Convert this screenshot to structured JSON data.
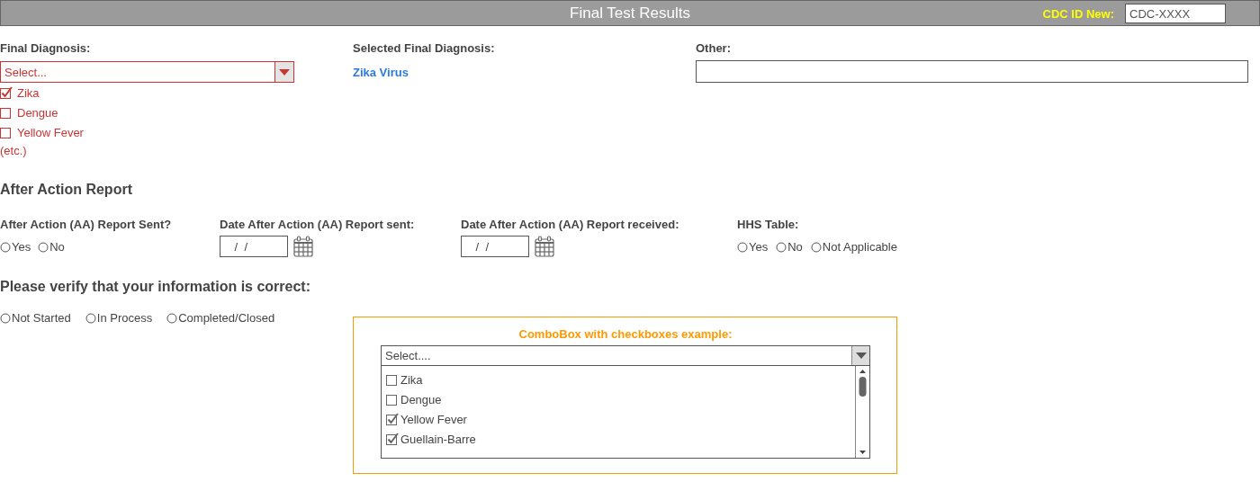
{
  "header": {
    "title": "Final Test Results",
    "id_label": "CDC ID New:",
    "id_value": "CDC-XXXX"
  },
  "final_diagnosis": {
    "label": "Final Diagnosis:",
    "placeholder": "Select...",
    "options": [
      {
        "label": "Zika",
        "checked": true
      },
      {
        "label": "Dengue",
        "checked": false
      },
      {
        "label": "Yellow Fever",
        "checked": false
      }
    ],
    "note": "(etc.)"
  },
  "selected_final_diagnosis": {
    "label": "Selected Final Diagnosis:",
    "value": "Zika Virus"
  },
  "other": {
    "label": "Other:"
  },
  "after_action": {
    "heading": "After Action Report",
    "report_sent": {
      "label": "After Action (AA) Report Sent?",
      "options": [
        {
          "label": "Yes",
          "selected": false
        },
        {
          "label": "No",
          "selected": false
        }
      ]
    },
    "date_sent": {
      "label": "Date After Action (AA) Report sent:",
      "value": " /  /"
    },
    "date_received": {
      "label": "Date After Action (AA) Report received:",
      "value": " /  /"
    },
    "hhs_table": {
      "label": "HHS Table:",
      "options": [
        {
          "label": "Yes",
          "selected": false
        },
        {
          "label": "No",
          "selected": false
        },
        {
          "label": "Not Applicable",
          "selected": false
        }
      ]
    }
  },
  "verify": {
    "heading": "Please verify that your information is correct:",
    "options": [
      {
        "label": "Not Started",
        "selected": false
      },
      {
        "label": "In Process",
        "selected": false
      },
      {
        "label": "Completed/Closed",
        "selected": false
      }
    ]
  },
  "combo_example": {
    "title": "ComboBox with checkboxes example:",
    "placeholder": "Select....",
    "options": [
      {
        "label": "Zika",
        "checked": false
      },
      {
        "label": "Dengue",
        "checked": false
      },
      {
        "label": "Yellow Fever",
        "checked": true
      },
      {
        "label": "Guellain-Barre",
        "checked": true
      }
    ]
  }
}
